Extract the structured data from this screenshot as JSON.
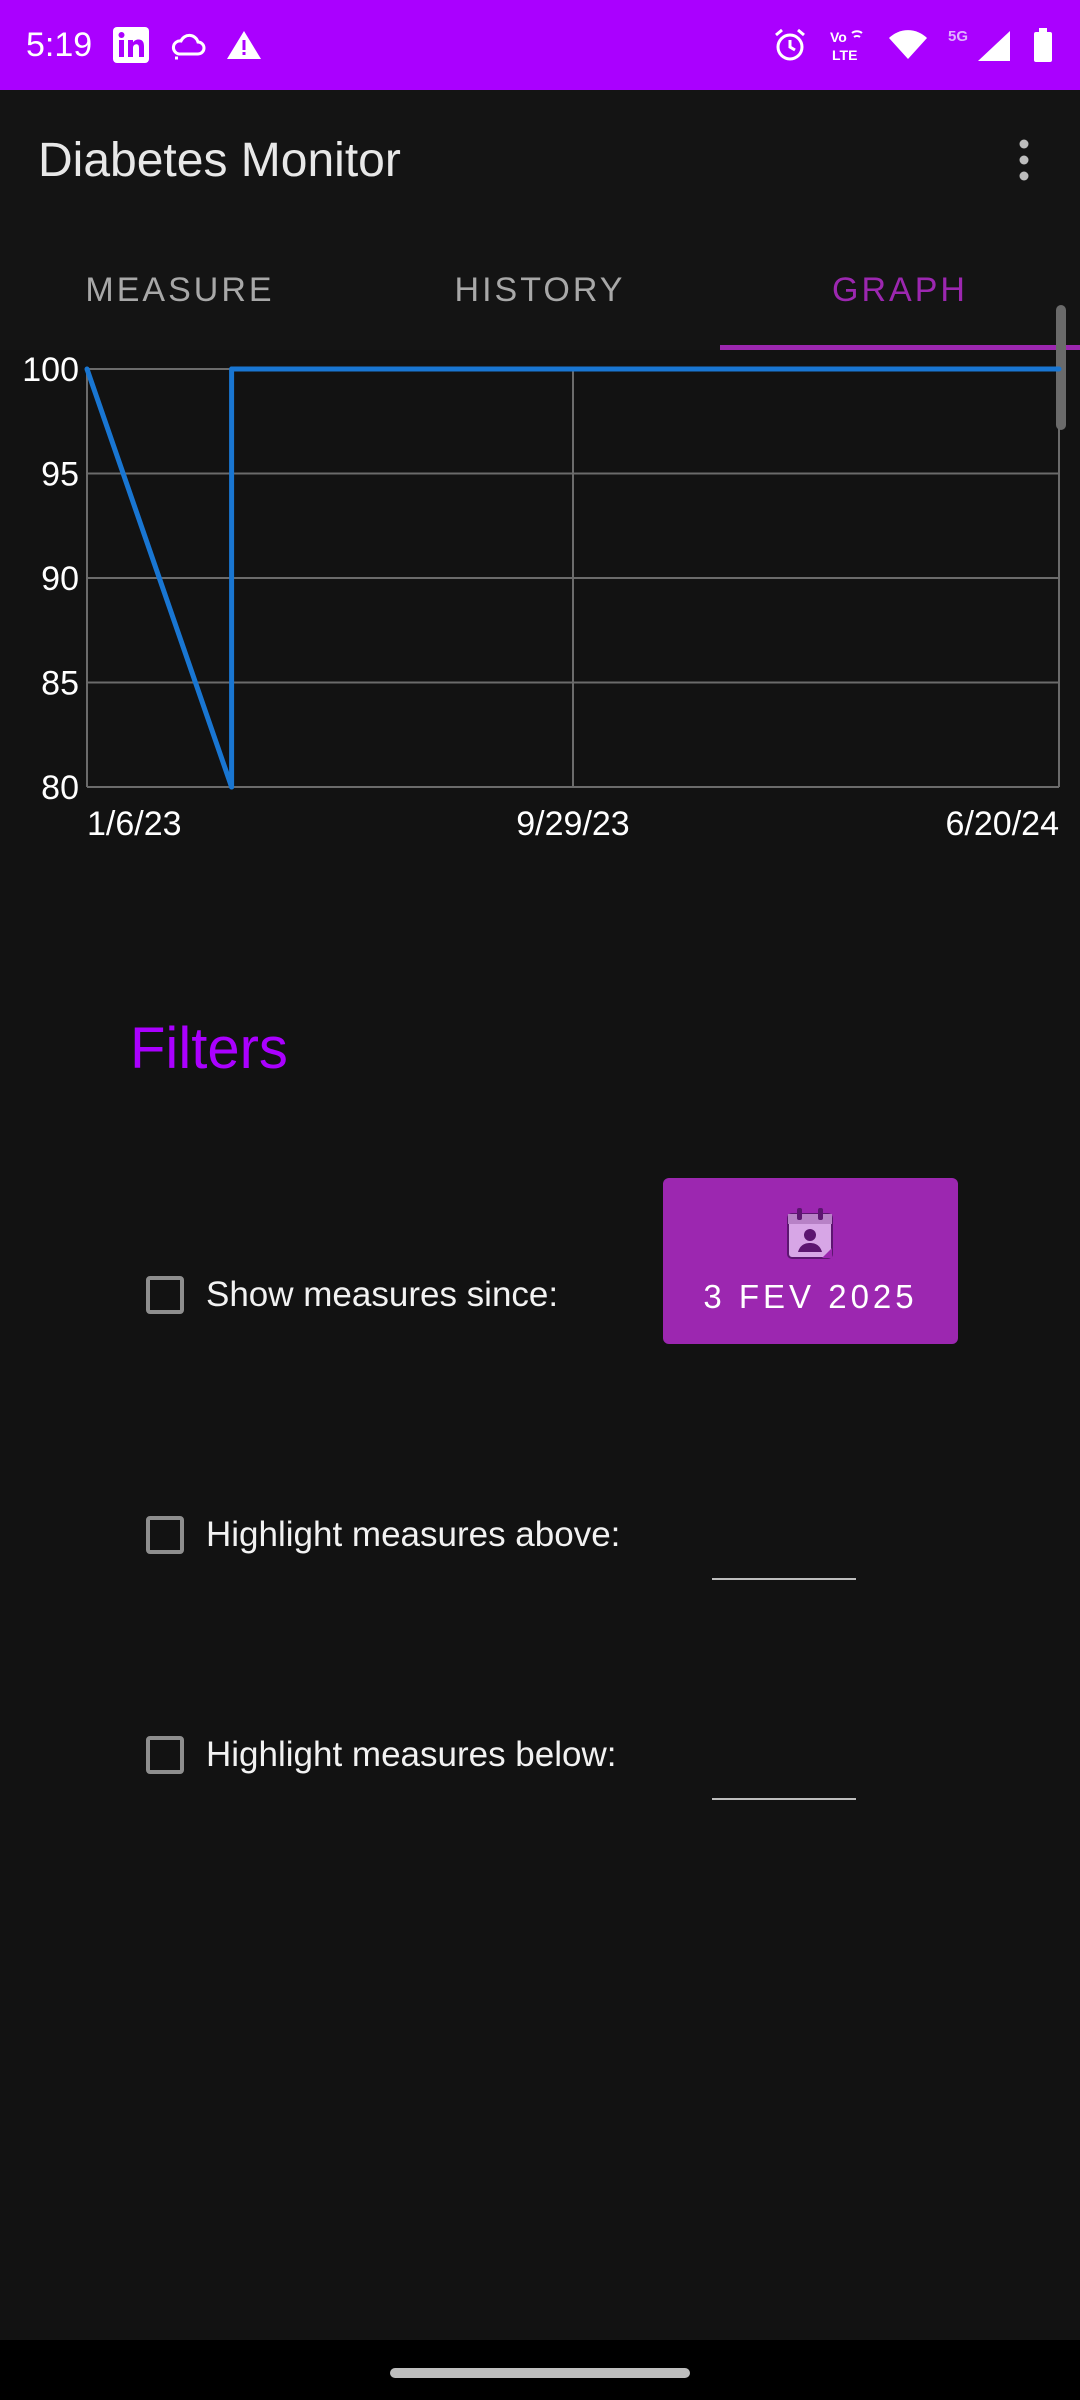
{
  "status_bar": {
    "time": "5:19",
    "color": "#aa00ff",
    "left_icons": [
      "linkedin-icon",
      "cloud-icon",
      "warning-icon"
    ],
    "right_icons": [
      "alarm-icon",
      "volte-icon",
      "wifi-icon",
      "signal-5g-icon",
      "battery-icon"
    ],
    "volte_text": "Vo» LTE",
    "network_text": "5G"
  },
  "app_bar": {
    "title": "Diabetes Monitor",
    "menu_icon": "more-vert-icon"
  },
  "tabs": [
    {
      "label": "MEASURE",
      "active": false
    },
    {
      "label": "HISTORY",
      "active": false
    },
    {
      "label": "GRAPH",
      "active": true
    }
  ],
  "chart_data": {
    "type": "line",
    "x_tick_labels": [
      "1/6/23",
      "9/29/23",
      "6/20/24"
    ],
    "y_tick_labels": [
      "100",
      "95",
      "90",
      "85",
      "80"
    ],
    "ylim": [
      80,
      100
    ],
    "xlim": [
      "2023-01-06",
      "2024-06-20"
    ],
    "grid": true,
    "line_color": "#1976d2",
    "series": [
      {
        "points": [
          {
            "x": "2023-01-06",
            "y": 100
          },
          {
            "x": "2023-03-26",
            "y": 80
          },
          {
            "x": "2023-03-26",
            "y": 100
          },
          {
            "x": "2024-06-20",
            "y": 100
          }
        ]
      }
    ]
  },
  "filters": {
    "title": "Filters",
    "show_since_label": "Show measures since:",
    "show_since_checked": false,
    "date_button_label": "3 FEV 2025",
    "date_icon": "calendar-icon",
    "highlight_above_label": "Highlight measures above:",
    "highlight_above_checked": false,
    "highlight_above_value": "",
    "highlight_below_label": "Highlight measures below:",
    "highlight_below_checked": false,
    "highlight_below_value": ""
  },
  "colors": {
    "accent": "#aa00ff",
    "tab_active": "#9c27b0",
    "background": "#121212"
  }
}
